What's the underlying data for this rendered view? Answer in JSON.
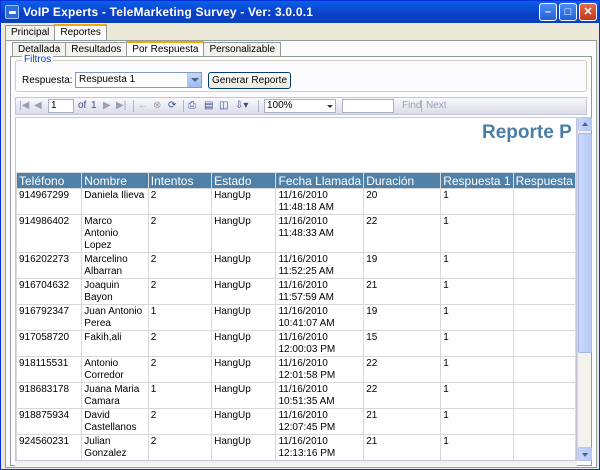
{
  "window": {
    "title": "VoIP Experts - TeleMarketing Survey - Ver: 3.0.0.1"
  },
  "top_tabs": [
    {
      "label": "Principal"
    },
    {
      "label": "Reportes"
    }
  ],
  "sub_tabs": [
    {
      "label": "Detallada"
    },
    {
      "label": "Resultados"
    },
    {
      "label": "Por Respuesta"
    },
    {
      "label": "Personalizable"
    }
  ],
  "filters": {
    "legend": "Filtros",
    "respuesta_label": "Respuesta:",
    "respuesta_value": "Respuesta 1",
    "generate_button": "Generar Reporte"
  },
  "toolbar": {
    "page_value": "1",
    "of_label": "of",
    "total_pages": "1",
    "zoom": "100%",
    "find_label": "Find",
    "next_label": "Next"
  },
  "report": {
    "title": "Reporte P",
    "columns": [
      "Teléfono",
      "Nombre",
      "Intentos",
      "Estado",
      "Fecha Llamada",
      "Duración",
      "Respuesta 1",
      "Respuesta"
    ],
    "rows": [
      [
        "914967299",
        "Daniela Ilieva",
        "2",
        "HangUp",
        "11/16/2010 11:48:18 AM",
        "20",
        "1",
        ""
      ],
      [
        "914986402",
        "Marco Antonio Lopez",
        "2",
        "HangUp",
        "11/16/2010 11:48:33 AM",
        "22",
        "1",
        ""
      ],
      [
        "916202273",
        "Marcelino Albarran",
        "2",
        "HangUp",
        "11/16/2010 11:52:25 AM",
        "19",
        "1",
        ""
      ],
      [
        "916704632",
        "Joaquin Bayon",
        "2",
        "HangUp",
        "11/16/2010 11:57:59 AM",
        "21",
        "1",
        ""
      ],
      [
        "916792347",
        "Juan Antonio Perea",
        "1",
        "HangUp",
        "11/16/2010 10:41:07 AM",
        "19",
        "1",
        ""
      ],
      [
        "917058720",
        "Fakih,ali",
        "2",
        "HangUp",
        "11/16/2010 12:00:03 PM",
        "15",
        "1",
        ""
      ],
      [
        "918115531",
        "Antonio Corredor",
        "2",
        "HangUp",
        "11/16/2010 12:01:58 PM",
        "22",
        "1",
        ""
      ],
      [
        "918683178",
        "Juana Maria Camara",
        "1",
        "HangUp",
        "11/16/2010 10:51:35 AM",
        "22",
        "1",
        ""
      ],
      [
        "918875934",
        "David Castellanos",
        "2",
        "HangUp",
        "11/16/2010 12:07:45 PM",
        "21",
        "1",
        ""
      ],
      [
        "924560231",
        "Julian Gonzalez",
        "2",
        "HangUp",
        "11/16/2010 12:13:16 PM",
        "21",
        "1",
        ""
      ]
    ]
  }
}
